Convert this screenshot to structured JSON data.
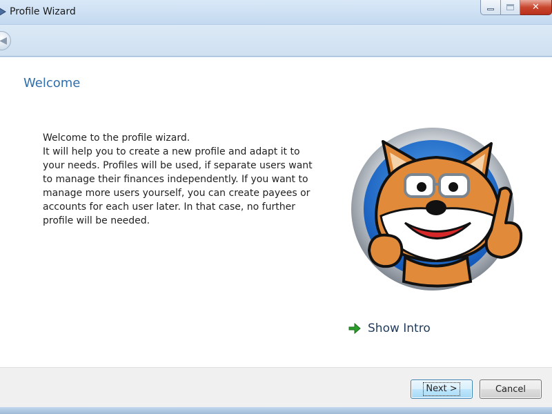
{
  "window": {
    "title": "Profile Wizard",
    "icon": "app-icon",
    "controls": [
      "minimize-icon",
      "maximize-icon",
      "close-icon"
    ]
  },
  "nav": {
    "back_icon": "back-arrow-icon"
  },
  "page": {
    "heading": "Welcome",
    "intro_lines": [
      "Welcome to the profile wizard.",
      "It will help you to create a new profile and adapt it to",
      "your needs. Profiles will be used, if separate users want",
      "to manage their finances independently. If you want to",
      "manage more users yourself, you can create payees or",
      "accounts for each user later. In that case, no further",
      "profile will be needed."
    ],
    "mascot": "fox-mascot-image",
    "show_intro": {
      "label": "Show Intro",
      "icon": "green-arrow-icon"
    }
  },
  "footer": {
    "next_label": "Next >",
    "cancel_label": "Cancel"
  },
  "colors": {
    "heading": "#2f6eac",
    "accent_arrow": "#2a9d2a",
    "title_bar": "#c4daf0",
    "close_button": "#c9472f"
  }
}
